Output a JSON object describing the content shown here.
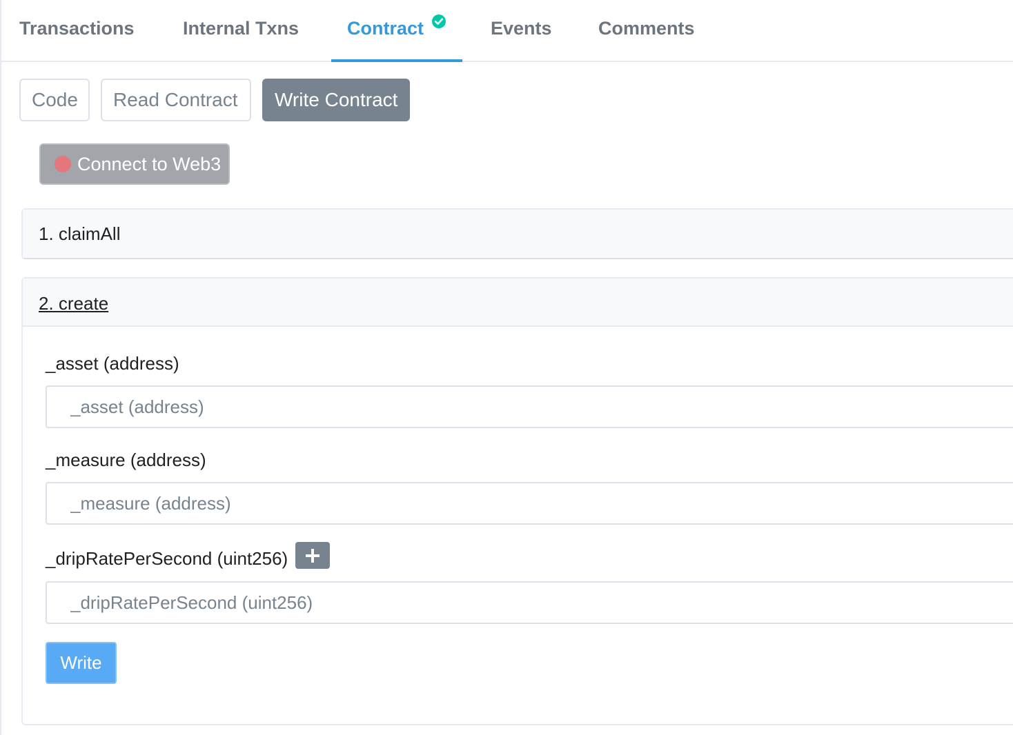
{
  "tabs": [
    {
      "label": "Transactions",
      "active": false
    },
    {
      "label": "Internal Txns",
      "active": false
    },
    {
      "label": "Contract",
      "active": true,
      "verified_icon": "check-circle-icon"
    },
    {
      "label": "Events",
      "active": false
    },
    {
      "label": "Comments",
      "active": false
    }
  ],
  "subtabs": {
    "code": "Code",
    "read": "Read Contract",
    "write": "Write Contract",
    "active": "Write Contract"
  },
  "connect": {
    "label": "Connect to Web3",
    "status_color": "#e4767c",
    "status_icon": "status-dot-icon"
  },
  "functions": [
    {
      "title": "1. claimAll",
      "expanded": false
    },
    {
      "title": "2. create",
      "expanded": true,
      "inputs": [
        {
          "label": "_asset (address)",
          "placeholder": "_asset (address)",
          "value": ""
        },
        {
          "label": "_measure (address)",
          "placeholder": "_measure (address)",
          "value": ""
        },
        {
          "label": "_dripRatePerSecond (uint256)",
          "placeholder": "_dripRatePerSecond (uint256)",
          "value": "",
          "helper_icon": "plus-icon"
        }
      ],
      "submit_label": "Write"
    }
  ],
  "colors": {
    "accent": "#3498db",
    "verified": "#00c9a7",
    "write_button": "#58aaf5",
    "secondary": "#77838f"
  }
}
